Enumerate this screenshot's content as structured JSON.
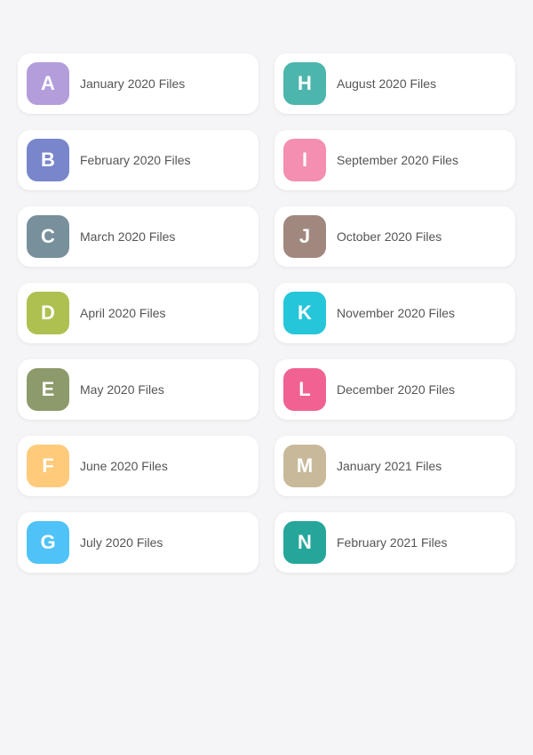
{
  "items": [
    {
      "id": "a",
      "letter": "A",
      "label": "January 2020 Files",
      "color": "#b39ddb"
    },
    {
      "id": "h",
      "letter": "H",
      "label": "August 2020 Files",
      "color": "#4db6ac"
    },
    {
      "id": "b",
      "letter": "B",
      "label": "February 2020 Files",
      "color": "#7986cb"
    },
    {
      "id": "i",
      "letter": "I",
      "label": "September 2020 Files",
      "color": "#f48fb1"
    },
    {
      "id": "c",
      "letter": "C",
      "label": "March 2020 Files",
      "color": "#78909c"
    },
    {
      "id": "j",
      "letter": "J",
      "label": "October 2020 Files",
      "color": "#a1887f"
    },
    {
      "id": "d",
      "letter": "D",
      "label": "April 2020 Files",
      "color": "#aec050"
    },
    {
      "id": "k",
      "letter": "K",
      "label": "November 2020 Files",
      "color": "#26c6da"
    },
    {
      "id": "e",
      "letter": "E",
      "label": "May 2020 Files",
      "color": "#8d9a6b"
    },
    {
      "id": "l",
      "letter": "L",
      "label": "December 2020 Files",
      "color": "#f06292"
    },
    {
      "id": "f",
      "letter": "F",
      "label": "June 2020 Files",
      "color": "#ffca7a"
    },
    {
      "id": "m",
      "letter": "M",
      "label": "January 2021 Files",
      "color": "#c8b99a"
    },
    {
      "id": "g",
      "letter": "G",
      "label": "July 2020 Files",
      "color": "#4fc3f7"
    },
    {
      "id": "n",
      "letter": "N",
      "label": "February 2021 Files",
      "color": "#26a69a"
    }
  ]
}
